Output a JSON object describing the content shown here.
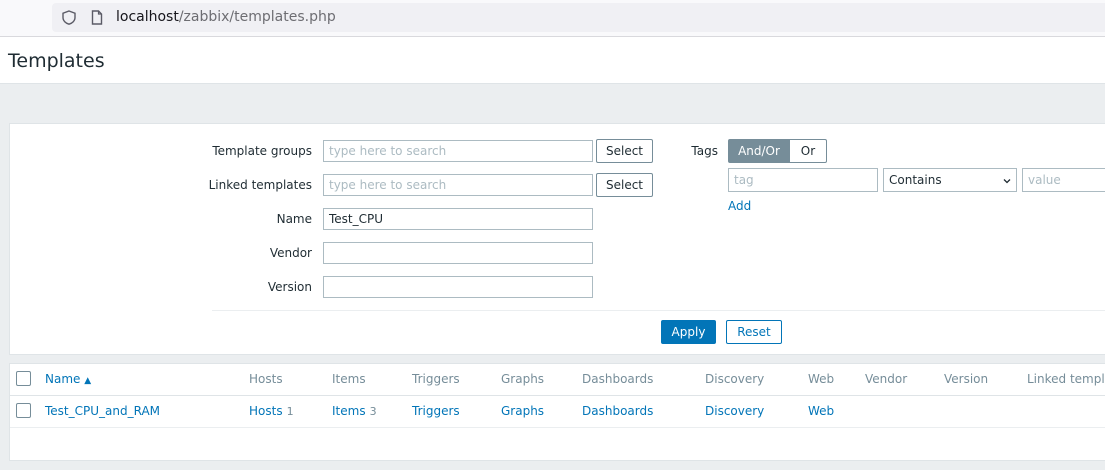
{
  "browser": {
    "url_host": "localhost",
    "url_path": "/zabbix/templates.php"
  },
  "page": {
    "title": "Templates"
  },
  "filter": {
    "template_groups": {
      "label": "Template groups",
      "placeholder": "type here to search",
      "select_label": "Select"
    },
    "linked_templates": {
      "label": "Linked templates",
      "placeholder": "type here to search",
      "select_label": "Select"
    },
    "name": {
      "label": "Name",
      "value": "Test_CPU"
    },
    "vendor": {
      "label": "Vendor",
      "value": ""
    },
    "version": {
      "label": "Version",
      "value": ""
    },
    "tags": {
      "label": "Tags",
      "andor_label": "And/Or",
      "or_label": "Or",
      "tag_placeholder": "tag",
      "operator_value": "Contains",
      "value_placeholder": "value",
      "add_label": "Add"
    },
    "apply_label": "Apply",
    "reset_label": "Reset"
  },
  "table": {
    "columns": [
      "Name",
      "Hosts",
      "Items",
      "Triggers",
      "Graphs",
      "Dashboards",
      "Discovery",
      "Web",
      "Vendor",
      "Version",
      "Linked templates"
    ],
    "sort_indicator": "▲",
    "rows": [
      {
        "name": "Test_CPU_and_RAM",
        "hosts": "Hosts",
        "hosts_count": "1",
        "items": "Items",
        "items_count": "3",
        "triggers": "Triggers",
        "graphs": "Graphs",
        "dashboards": "Dashboards",
        "discovery": "Discovery",
        "web": "Web"
      }
    ]
  }
}
